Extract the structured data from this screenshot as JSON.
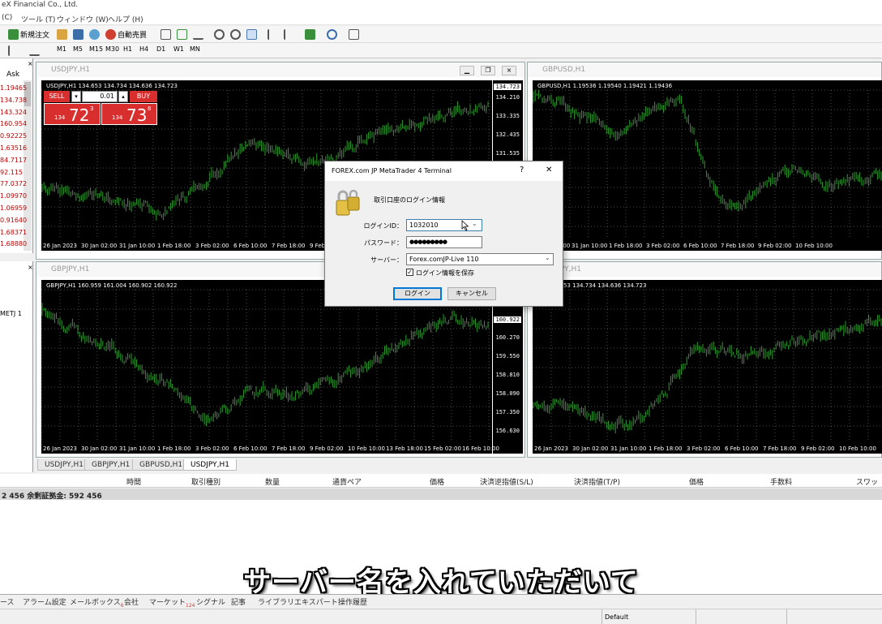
{
  "window": {
    "title": "eX Financial Co., Ltd."
  },
  "menu": [
    "(C)",
    "ツール (T)",
    "ウィンドウ (W)",
    "ヘルプ (H)"
  ],
  "toolbar": {
    "new_order": "新規注文",
    "auto_trade": "自動売買"
  },
  "timeframes": [
    "M1",
    "M5",
    "M15",
    "M30",
    "H1",
    "H4",
    "D1",
    "W1",
    "MN"
  ],
  "market_watch": {
    "header": "Ask",
    "asks": [
      "1.19465",
      "134.738",
      "143.324",
      "160.954",
      "0.92225",
      "1.63516",
      "84.7117",
      "92.115",
      "77.0372",
      "1.09970",
      "1.06959",
      "0.91640",
      "1.68371",
      "1.68880"
    ]
  },
  "navigator": {
    "item": "METJ 1"
  },
  "charts": [
    {
      "title": "USDJPY,H1",
      "symline": "USDJPY,H1  134.653 134.734 134.636 134.723",
      "current": "134.723",
      "prices": [
        "134.210",
        "133.335",
        "132.435",
        "131.535"
      ],
      "times": [
        "26 Jan 2023",
        "30 Jan 02:00",
        "31 Jan 10:00",
        "1 Feb 18:00",
        "3 Feb 02:00",
        "6 Feb 10:00",
        "7 Feb 18:00",
        "9 Feb"
      ]
    },
    {
      "title": "GBPUSD,H1",
      "symline": "GBPUSD,H1  1.19536 1.19540 1.19421 1.19436",
      "times": [
        "30 Jan 02:00",
        "31 Jan 10:00",
        "1 Feb 18:00",
        "3 Feb 02:00",
        "6 Feb 10:00",
        "7 Feb 18:00",
        "9 Feb 02:00",
        "10 Feb 10:00"
      ]
    },
    {
      "title": "GBPJPY,H1",
      "symline": "GBPJPY,H1  160.959 161.004 160.902 160.922",
      "current": "160.922",
      "prices": [
        "160.270",
        "159.550",
        "158.810",
        "158.090",
        "157.350",
        "156.630"
      ],
      "times": [
        "26 Jan 2023",
        "30 Jan 02:00",
        "31 Jan 10:00",
        "1 Feb 18:00",
        "3 Feb 02:00",
        "6 Feb 10:00",
        "7 Feb 18:00",
        "9 Feb 02:00",
        "10 Feb 10:00",
        "13 Feb 18:00",
        "15 Feb 02:00",
        "16 Feb 10:00"
      ]
    },
    {
      "title": "USDJPY,H1",
      "symline": "H1  134.653 134.734 134.636 134.723",
      "times": [
        "26 Jan 2023",
        "30 Jan 02:00",
        "31 Jan 10:00",
        "1 Feb 18:00",
        "3 Feb 02:00",
        "6 Feb 10:00",
        "7 Feb 18:00",
        "9 Feb 02:00",
        "10 Feb 10:00"
      ]
    }
  ],
  "one_click": {
    "sell": "SELL",
    "buy": "BUY",
    "lot": "0.01",
    "sell_big": "72",
    "sell_sup": "3",
    "sell_small": "134",
    "buy_big": "73",
    "buy_sup": "8",
    "buy_small": "134"
  },
  "chart_tabs": [
    "USDJPY,H1",
    "GBPJPY,H1",
    "GBPUSD,H1",
    "USDJPY,H1"
  ],
  "terminal": {
    "columns": [
      "時間",
      "取引種別",
      "数量",
      "通貨ペア",
      "価格",
      "決済逆指値(S/L)",
      "決済指値(T/P)",
      "価格",
      "手数料",
      "スワップ"
    ],
    "balance": "2 456  余剰証拠金: 592 456"
  },
  "bottom_tabs": [
    "ース",
    "アラーム設定",
    "メールボックス",
    "会社",
    "マーケット",
    "シグナル",
    "記事",
    "ライブラリ",
    "エキスパート",
    "操作履歴"
  ],
  "bottom_tab_badges": {
    "mailbox": "6",
    "market": "124"
  },
  "status": {
    "profile": "Default"
  },
  "subtitle": "サーバー名を入れていただいて",
  "dialog": {
    "title": "FOREX.com JP MetaTrader 4 Terminal",
    "help": "?",
    "close": "✕",
    "heading": "取引口座のログイン情報",
    "login_label": "ログインID：",
    "login_value": "1032010",
    "password_label": "パスワード：",
    "password_value": "●●●●●●●●●",
    "server_label": "サーバー：",
    "server_value": "Forex.comJP-Live 110",
    "save_label": "ログイン情報を保存",
    "login_button": "ログイン",
    "cancel_button": "キャンセル"
  }
}
